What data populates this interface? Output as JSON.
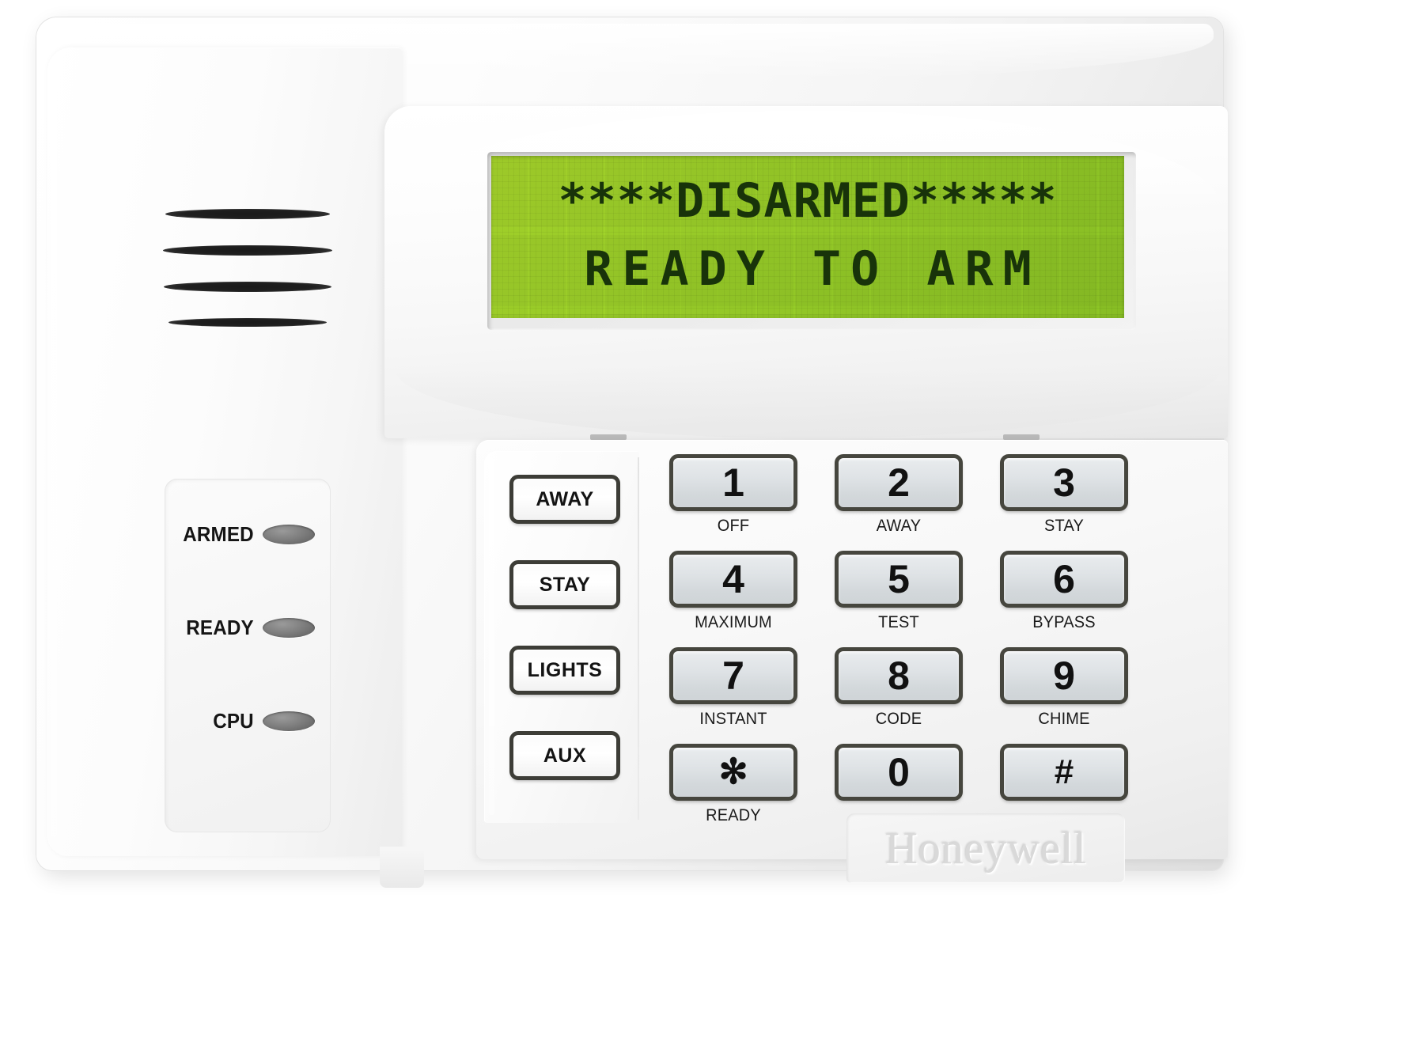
{
  "device": {
    "brand": "Honeywell",
    "product_label": "Honeywell"
  },
  "display": {
    "line1": "****DISARMED*****",
    "line2": "READY TO ARM",
    "backlight_color": "#9ed229",
    "text_color": "#18330a"
  },
  "status_leds": [
    {
      "label": "ARMED",
      "state": "off",
      "color": "#7f7f7f"
    },
    {
      "label": "READY",
      "state": "off",
      "color": "#7f7f7f"
    },
    {
      "label": "CPU",
      "state": "off",
      "color": "#7f7f7f"
    }
  ],
  "function_keys": [
    {
      "label": "AWAY"
    },
    {
      "label": "STAY"
    },
    {
      "label": "LIGHTS"
    },
    {
      "label": "AUX"
    }
  ],
  "keypad": [
    {
      "key": "1",
      "sub": "OFF"
    },
    {
      "key": "2",
      "sub": "AWAY"
    },
    {
      "key": "3",
      "sub": "STAY"
    },
    {
      "key": "4",
      "sub": "MAXIMUM"
    },
    {
      "key": "5",
      "sub": "TEST"
    },
    {
      "key": "6",
      "sub": "BYPASS"
    },
    {
      "key": "7",
      "sub": "INSTANT"
    },
    {
      "key": "8",
      "sub": "CODE"
    },
    {
      "key": "9",
      "sub": "CHIME"
    },
    {
      "key": "✻",
      "sub": "READY"
    },
    {
      "key": "0",
      "sub": ""
    },
    {
      "key": "#",
      "sub": ""
    }
  ]
}
